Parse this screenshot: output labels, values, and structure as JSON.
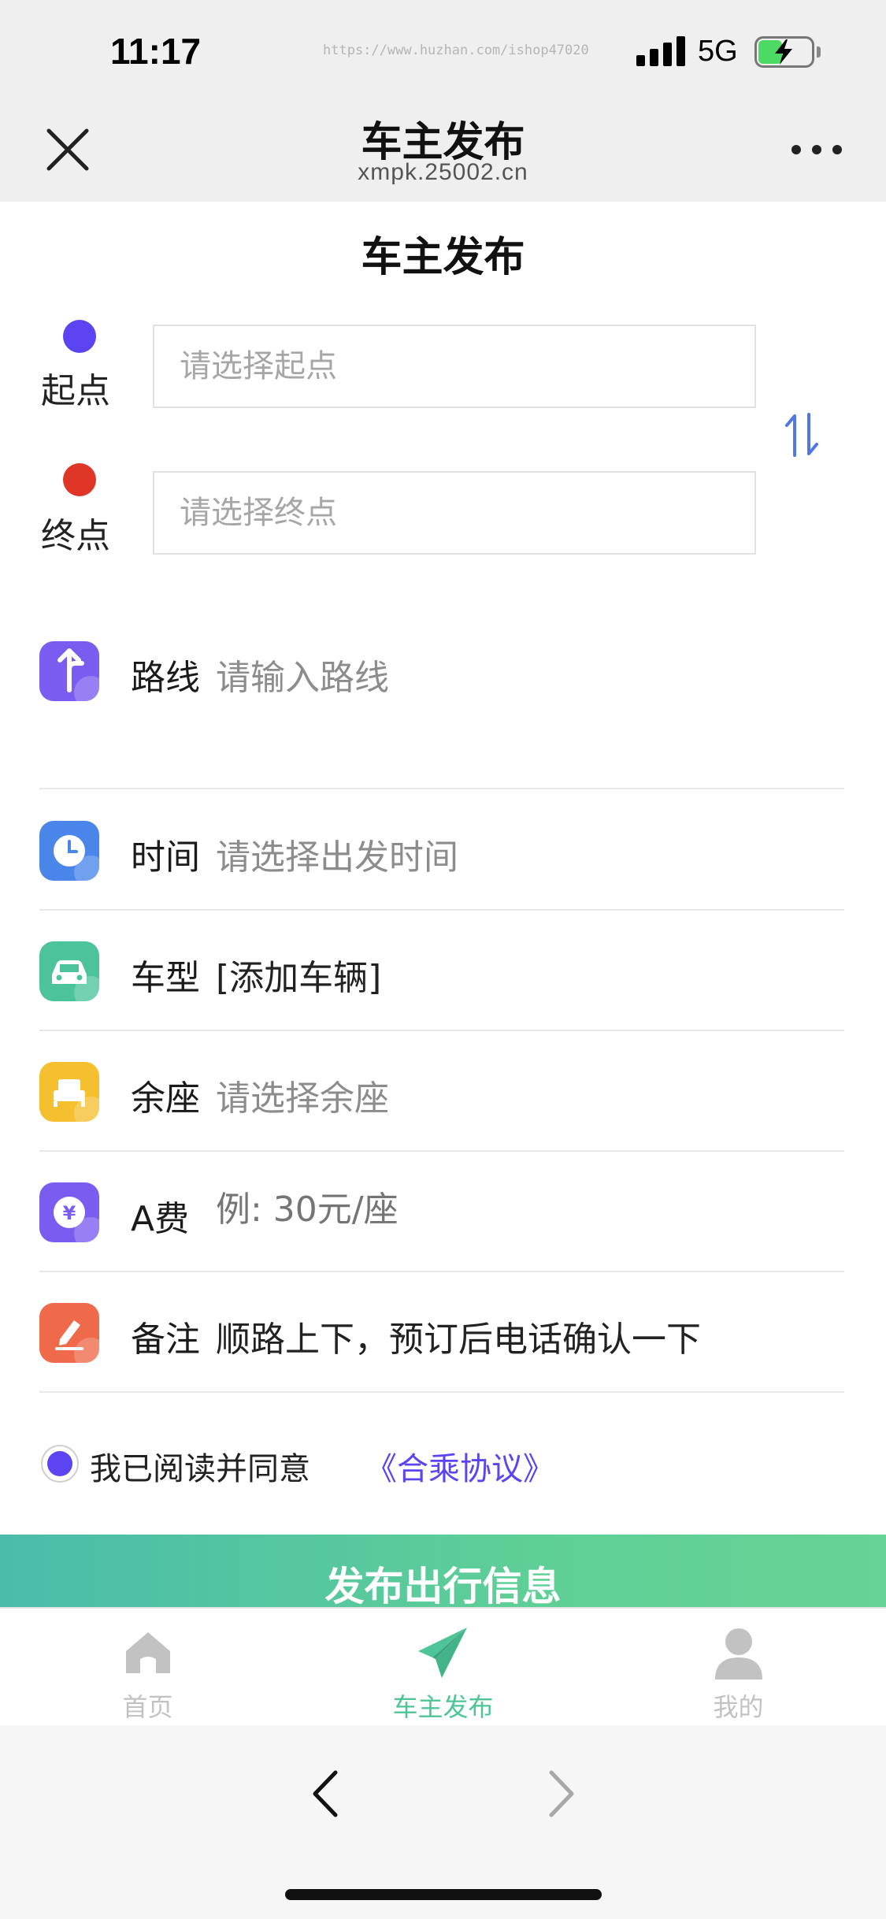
{
  "status_bar": {
    "time": "11:17",
    "watermark": "https://www.huzhan.com/ishop47020",
    "network": "5G",
    "battery_level": 0.45,
    "battery_charging": true
  },
  "nav": {
    "title": "车主发布",
    "subtitle": "xmpk.25002.cn",
    "close_icon": "close-icon",
    "more_icon": "more-icon"
  },
  "page": {
    "heading": "车主发布"
  },
  "origin": {
    "label": "起点",
    "placeholder": "请选择起点",
    "value": "",
    "dot_color": "#5b44f2"
  },
  "destination": {
    "label": "终点",
    "placeholder": "请选择终点",
    "value": "",
    "dot_color": "#e03628"
  },
  "swap_icon": "swap-icon",
  "form": {
    "route": {
      "label": "路线",
      "value": "请输入路线",
      "icon": "route-icon",
      "color": "#7b5cf0"
    },
    "time": {
      "label": "时间",
      "value": "请选择出发时间",
      "icon": "clock-icon",
      "color": "#4a86ea"
    },
    "vehicle": {
      "label": "车型",
      "value": "[添加车辆]",
      "icon": "car-icon",
      "color": "#4cc39a"
    },
    "seats": {
      "label": "余座",
      "value": "请选择余座",
      "icon": "seat-icon",
      "color": "#f5c030"
    },
    "fee": {
      "label": "A费",
      "value": "例: 30元/座",
      "icon": "yuan-icon",
      "color": "#7b5cf0"
    },
    "remark": {
      "label": "备注",
      "value": "顺路上下，预订后电话确认一下",
      "icon": "pencil-icon",
      "color": "#ef6a4a"
    }
  },
  "agreement": {
    "text": "我已阅读并同意",
    "link": "《合乘协议》",
    "checked": true,
    "accent": "#5b44f2"
  },
  "publish_button": {
    "label": "发布出行信息"
  },
  "tab_bar": {
    "active_color": "#4fc597",
    "inactive_color": "#c2c2c2",
    "tabs": [
      {
        "label": "首页",
        "icon": "home-icon",
        "active": false
      },
      {
        "label": "车主发布",
        "icon": "send-icon",
        "active": true
      },
      {
        "label": "我的",
        "icon": "user-icon",
        "active": false
      }
    ]
  },
  "browser": {
    "back_icon": "back-icon",
    "forward_icon": "forward-icon"
  }
}
